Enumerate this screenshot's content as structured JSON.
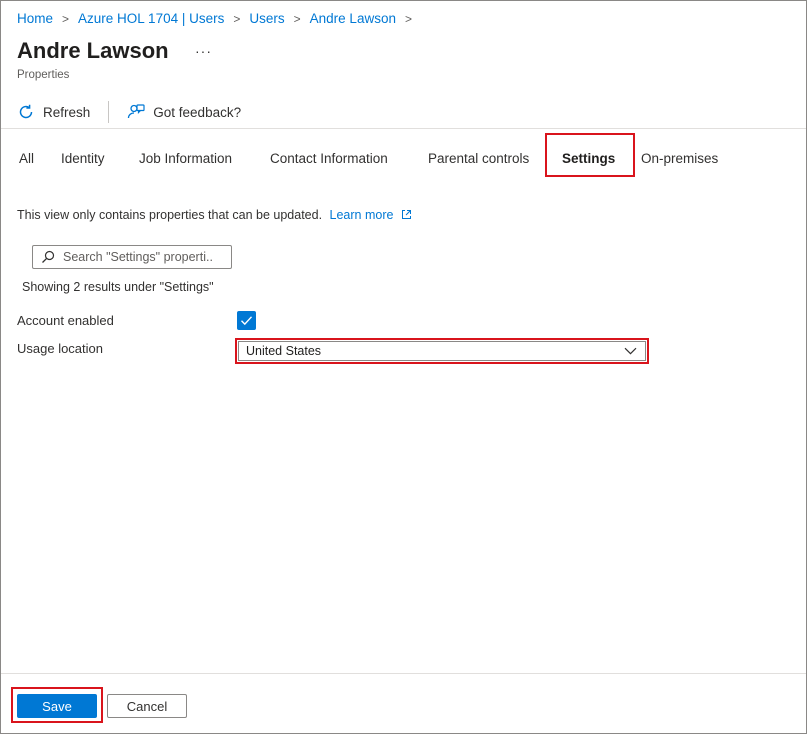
{
  "breadcrumb": [
    {
      "label": "Home"
    },
    {
      "label": "Azure HOL 1704 | Users"
    },
    {
      "label": "Users"
    },
    {
      "label": "Andre Lawson"
    }
  ],
  "header": {
    "title": "Andre Lawson",
    "more_label": "···",
    "subtitle": "Properties"
  },
  "toolbar": {
    "refresh_label": "Refresh",
    "feedback_label": "Got feedback?"
  },
  "tabs": [
    {
      "label": "All"
    },
    {
      "label": "Identity"
    },
    {
      "label": "Job Information"
    },
    {
      "label": "Contact Information"
    },
    {
      "label": "Parental controls"
    },
    {
      "label": "Settings",
      "active": true
    },
    {
      "label": "On-premises"
    }
  ],
  "info": {
    "text": "This view only contains properties that can be updated.",
    "link_label": "Learn more"
  },
  "search": {
    "placeholder": "Search \"Settings\" properti..."
  },
  "results_text": "Showing 2 results under \"Settings\"",
  "properties": {
    "account_enabled": {
      "label": "Account enabled",
      "checked": true
    },
    "usage_location": {
      "label": "Usage location",
      "value": "United States"
    }
  },
  "footer": {
    "save_label": "Save",
    "cancel_label": "Cancel"
  },
  "colors": {
    "accent": "#0078d4",
    "highlight": "#d9141c"
  },
  "icons": {
    "refresh": "refresh-icon",
    "feedback": "feedback-icon",
    "external_link": "external-link-icon",
    "search": "search-icon",
    "checkmark": "checkmark-icon",
    "chevron": "chevron-down-icon"
  }
}
